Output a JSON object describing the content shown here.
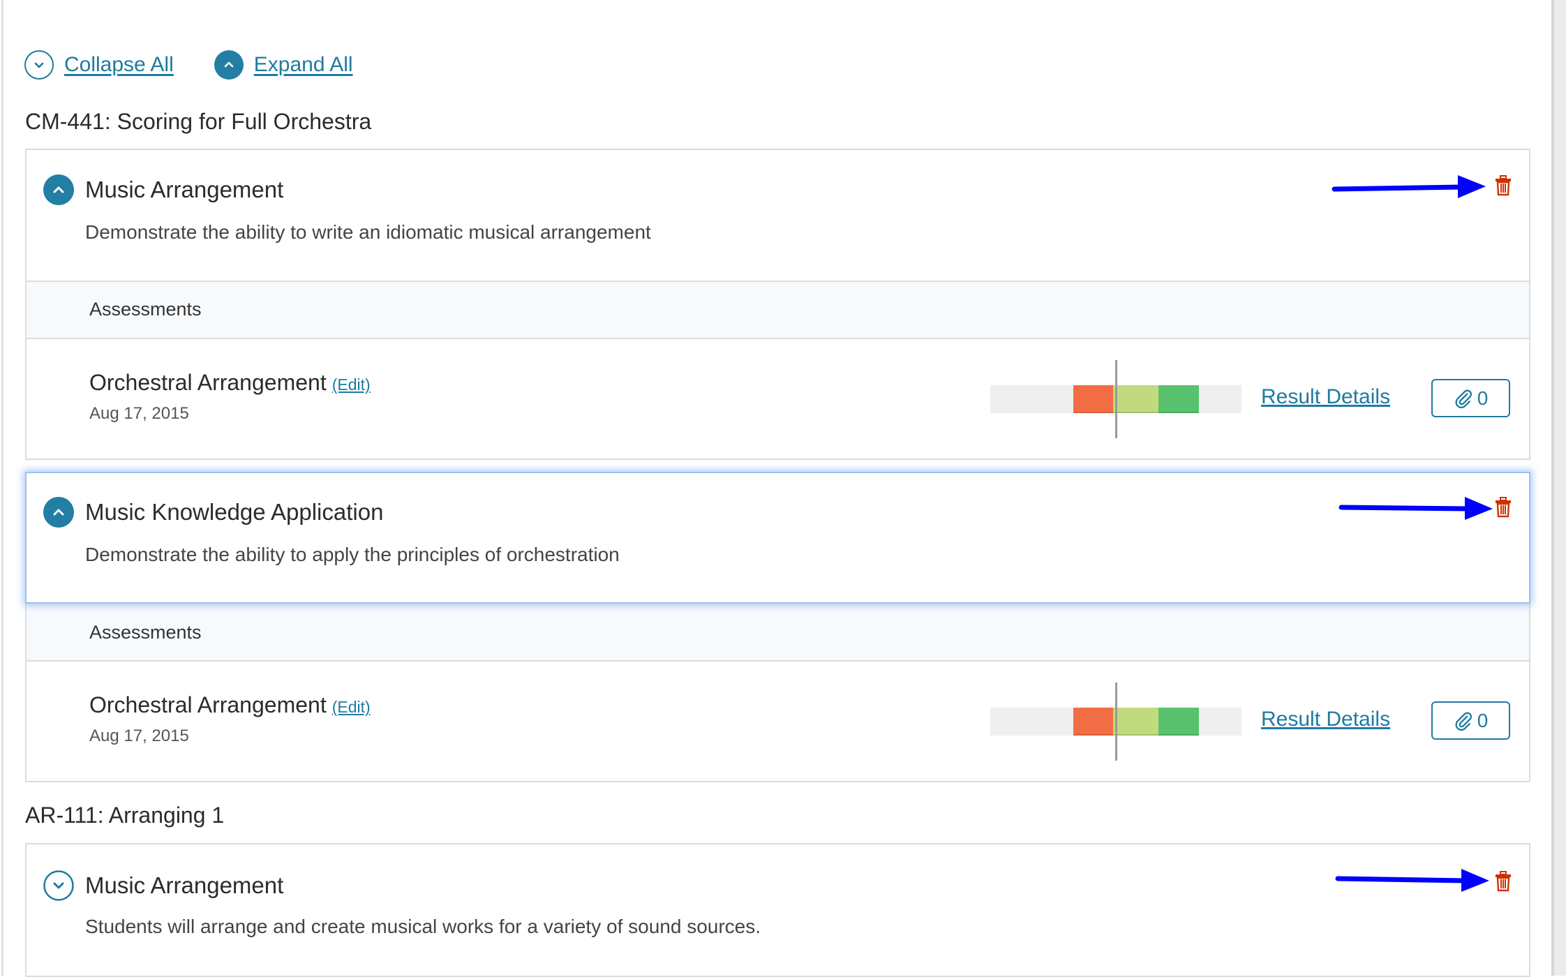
{
  "toolbar": {
    "collapse_all": "Collapse All",
    "expand_all": "Expand All"
  },
  "colors": {
    "accent": "#227ea3",
    "delete": "#cc3300",
    "annotation_arrow": "#0000ff",
    "perf_below": "#f26d44",
    "perf_near": "#c2da7e",
    "perf_meets": "#58c26e",
    "perf_track": "#efefef"
  },
  "courses": [
    {
      "heading": "CM-441: Scoring for Full Orchestra",
      "objectives": [
        {
          "title": "Music Arrangement",
          "description": "Demonstrate the ability to write an idiomatic musical arrangement",
          "expanded": true,
          "focused": false,
          "toggle_icon": "chevron-up-icon",
          "delete_icon": "trash-icon",
          "assessments_label": "Assessments",
          "assessments": [
            {
              "title": "Orchestral Arrangement",
              "edit_label": "(Edit)",
              "date": "Aug 17, 2015",
              "result_link": "Result Details",
              "attachment_count": "0",
              "performance": {
                "segments_start": 0.33,
                "below_end": 0.49,
                "near_end": 0.67,
                "meets_end": 0.83,
                "marker": 0.5
              }
            }
          ]
        },
        {
          "title": "Music Knowledge Application",
          "description": "Demonstrate the ability to apply the principles of orchestration",
          "expanded": true,
          "focused": true,
          "toggle_icon": "chevron-up-icon",
          "delete_icon": "trash-icon",
          "assessments_label": "Assessments",
          "assessments": [
            {
              "title": "Orchestral Arrangement",
              "edit_label": "(Edit)",
              "date": "Aug 17, 2015",
              "result_link": "Result Details",
              "attachment_count": "0",
              "performance": {
                "segments_start": 0.33,
                "below_end": 0.49,
                "near_end": 0.67,
                "meets_end": 0.83,
                "marker": 0.5
              }
            }
          ]
        }
      ]
    },
    {
      "heading": "AR-111: Arranging 1",
      "objectives": [
        {
          "title": "Music Arrangement",
          "description": "Students will arrange and create musical works for a variety of sound sources.",
          "expanded": false,
          "focused": false,
          "toggle_icon": "chevron-down-icon",
          "delete_icon": "trash-icon"
        }
      ]
    }
  ]
}
